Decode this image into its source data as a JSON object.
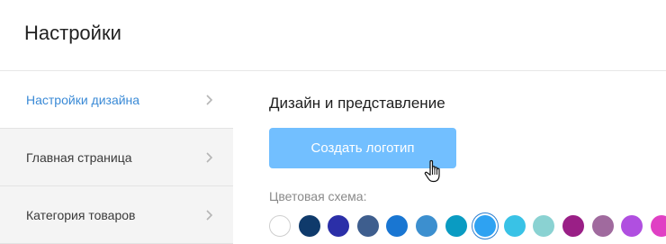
{
  "header": {
    "title": "Настройки"
  },
  "sidebar": {
    "items": [
      {
        "label": "Настройки дизайна",
        "active": true
      },
      {
        "label": "Главная страница",
        "active": false
      },
      {
        "label": "Категория товаров",
        "active": false
      }
    ]
  },
  "main": {
    "section_title": "Дизайн и представление",
    "logo_button_label": "Создать логотип",
    "color_scheme_label": "Цветовая схема:",
    "swatches": [
      {
        "color": "#ffffff",
        "selected": false
      },
      {
        "color": "#0f3a6b",
        "selected": false
      },
      {
        "color": "#2b2fa8",
        "selected": false
      },
      {
        "color": "#3e5e8e",
        "selected": false
      },
      {
        "color": "#1976d2",
        "selected": false
      },
      {
        "color": "#3c8fcf",
        "selected": false
      },
      {
        "color": "#0a9bc2",
        "selected": false
      },
      {
        "color": "#2ea2f2",
        "selected": true
      },
      {
        "color": "#39c2e6",
        "selected": false
      },
      {
        "color": "#8ad2d2",
        "selected": false
      },
      {
        "color": "#9a1f86",
        "selected": false
      },
      {
        "color": "#a06a9e",
        "selected": false
      },
      {
        "color": "#b04fe0",
        "selected": false
      },
      {
        "color": "#e040c4",
        "selected": false
      }
    ]
  },
  "colors": {
    "accent": "#3a8ad6",
    "button": "#72bfff"
  }
}
